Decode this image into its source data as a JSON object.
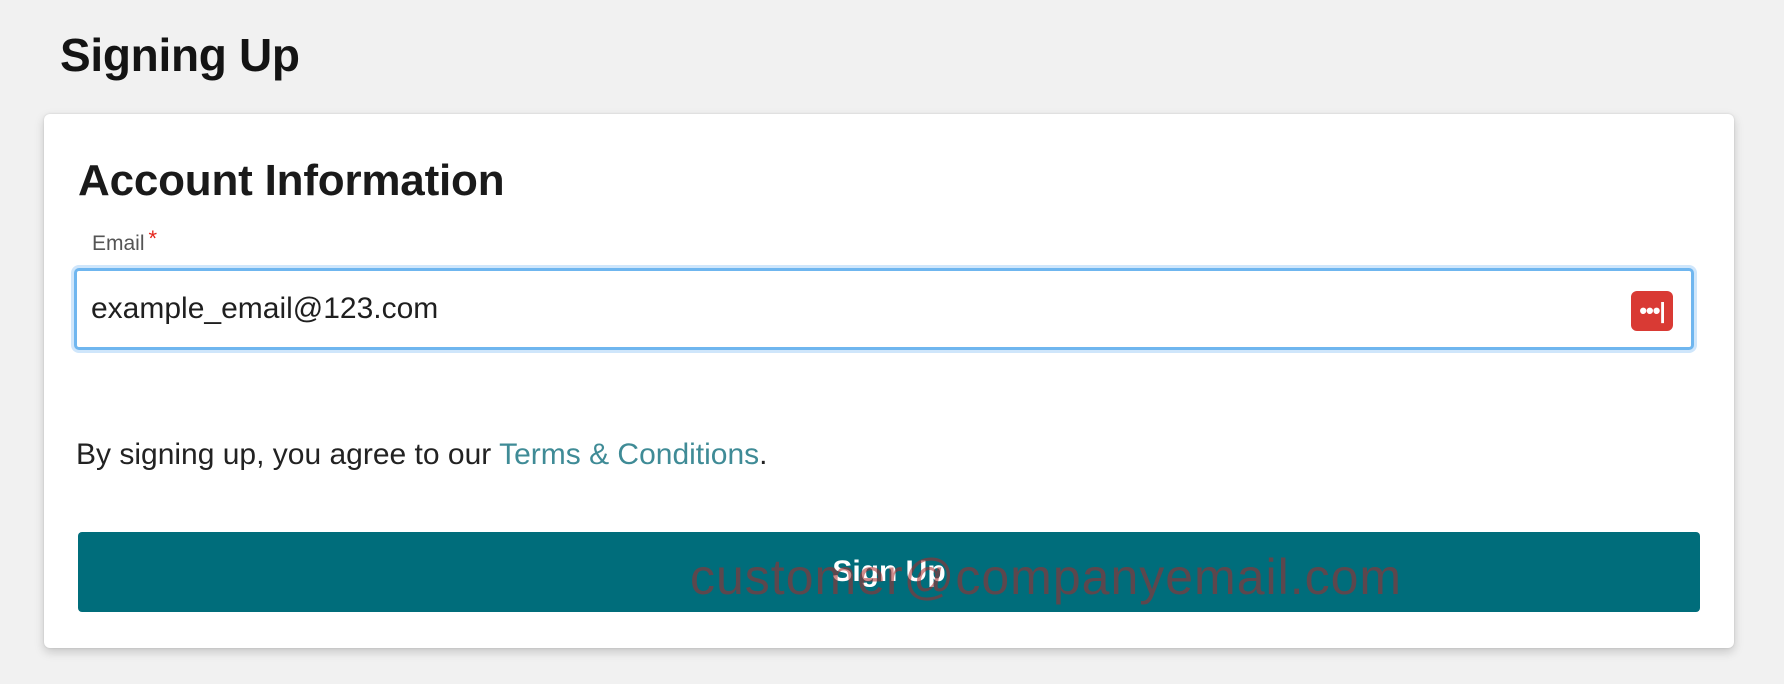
{
  "page": {
    "heading": "Signing Up"
  },
  "account": {
    "title": "Account Information",
    "email": {
      "label": "Email",
      "required_mark": "*",
      "value": "example_email@123.com"
    },
    "password_manager_icon": {
      "name": "password-manager-icon",
      "glyph": "•••|"
    },
    "terms": {
      "prefix": "By signing up, you agree to our ",
      "link_label": "Terms & Conditions",
      "suffix": "."
    },
    "signup_button_label": "Sign Up"
  },
  "overlay": {
    "watermark": "customer@companyemail.com"
  },
  "colors": {
    "background": "#f1f1f1",
    "button": "#006d7b",
    "link": "#3f8b96",
    "input_focus": "#6fb6ef",
    "required": "#e5241b",
    "icon": "#d93a34"
  }
}
